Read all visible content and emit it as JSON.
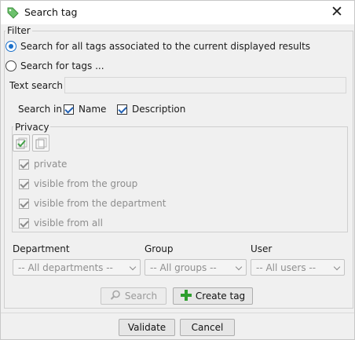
{
  "window": {
    "title": "Search tag",
    "close_glyph": "✕",
    "icon": "tag-icon"
  },
  "filter": {
    "legend": "Filter",
    "radio_all": {
      "label": "Search for all tags associated to the current displayed results",
      "selected": true
    },
    "radio_tags": {
      "label": "Search for tags ...",
      "selected": false
    },
    "text_search": {
      "label": "Text search",
      "value": "",
      "placeholder": ""
    },
    "search_in": {
      "label": "Search in",
      "name": {
        "label": "Name",
        "checked": true
      },
      "description": {
        "label": "Description",
        "checked": true
      }
    },
    "privacy": {
      "legend": "Privacy",
      "select_all_icon": "select-all-icon",
      "deselect_all_icon": "deselect-all-icon",
      "options": [
        {
          "label": "private",
          "checked": true
        },
        {
          "label": "visible from the group",
          "checked": true
        },
        {
          "label": "visible from the department",
          "checked": true
        },
        {
          "label": "visible from all",
          "checked": true
        }
      ]
    },
    "department": {
      "label": "Department",
      "selected": "-- All departments --"
    },
    "group": {
      "label": "Group",
      "selected": "-- All groups --"
    },
    "user": {
      "label": "User",
      "selected": "-- All users --"
    },
    "search_button": {
      "label": "Search",
      "icon": "search-icon",
      "enabled": false
    },
    "create_tag_button": {
      "label": "Create tag",
      "icon": "plus-icon",
      "enabled": true
    }
  },
  "footer": {
    "validate_label": "Validate",
    "cancel_label": "Cancel"
  },
  "colors": {
    "accent": "#1a6fc9",
    "tag_icon": "#5cb85c",
    "plus_icon": "#2e9e2e"
  }
}
